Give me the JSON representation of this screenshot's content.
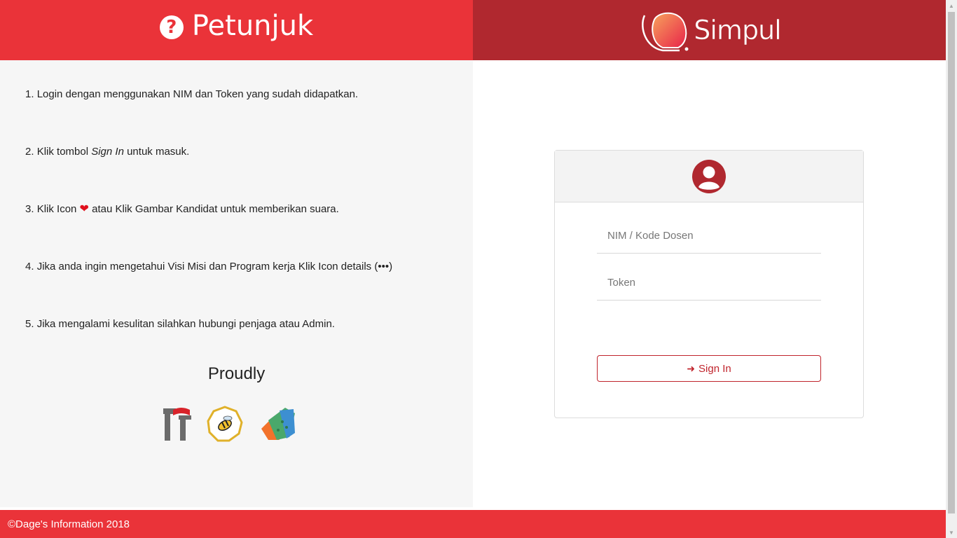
{
  "header": {
    "title": "Petunjuk",
    "logo_text": "Simpul",
    "help_icon": "question-circle-icon"
  },
  "steps": [
    {
      "num": "1.",
      "text": "Login dengan menggunakan NIM dan Token yang sudah didapatkan."
    },
    {
      "num": "2.",
      "before": "Klik tombol ",
      "em": "Sign In",
      "after": " untuk masuk."
    },
    {
      "num": "3.",
      "before": "Klik Icon ",
      "after": " atau Klik Gambar Kandidat untuk memberikan suara.",
      "icon": "heart-icon"
    },
    {
      "num": "4.",
      "text": "Jika anda ingin mengetahui Visi Misi dan Program kerja Klik Icon details (•••)"
    },
    {
      "num": "5.",
      "text": "Jika mengalami kesulitan silahkan hubungi penjaga atau Admin."
    }
  ],
  "proudly": "Proudly",
  "login": {
    "nim_placeholder": "NIM / Kode Dosen",
    "token_placeholder": "Token",
    "signin_label": "Sign In",
    "signin_icon": "sign-in-icon",
    "avatar_icon": "user-circle-icon"
  },
  "footer": {
    "text": "©Dage's Information 2018"
  },
  "colors": {
    "primary_red": "#ea3339",
    "dark_red": "#b0282f",
    "button_red": "#c0242c"
  }
}
